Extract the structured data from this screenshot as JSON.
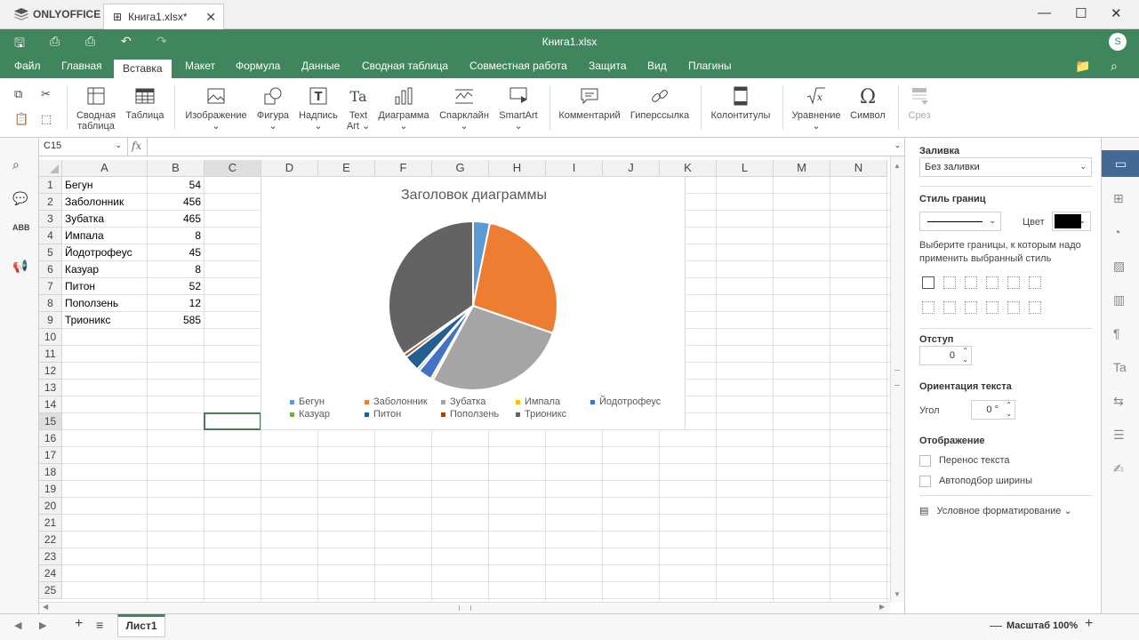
{
  "app": {
    "brand": "ONLYOFFICE",
    "doc_tab": "Книга1.xlsx*",
    "title": "Книга1.xlsx",
    "avatar": "S"
  },
  "menu": [
    "Файл",
    "Главная",
    "Вставка",
    "Макет",
    "Формула",
    "Данные",
    "Сводная таблица",
    "Совместная работа",
    "Защита",
    "Вид",
    "Плагины"
  ],
  "menu_active": "Вставка",
  "toolbar": {
    "pivot": [
      "Сводная",
      "таблица"
    ],
    "table": "Таблица",
    "image": "Изображение",
    "shape": "Фигура",
    "textbox": "Надпись",
    "textart": [
      "Text",
      "Art"
    ],
    "chart": "Диаграмма",
    "sparkline": "Спарклайн",
    "smartart": "SmartArt",
    "comment": "Комментарий",
    "hyperlink": "Гиперссылка",
    "headers": "Колонтитулы",
    "equation": "Уравнение",
    "symbol": "Символ",
    "slicer": "Срез"
  },
  "formula_bar": {
    "cell_ref": "C15",
    "fx": "fx",
    "value": ""
  },
  "columns": [
    "A",
    "B",
    "C",
    "D",
    "E",
    "F",
    "G",
    "H",
    "I",
    "J",
    "K",
    "L",
    "M",
    "N"
  ],
  "selected_col": "C",
  "selected_row": "15",
  "rows": [
    "1",
    "2",
    "3",
    "4",
    "5",
    "6",
    "7",
    "8",
    "9",
    "10",
    "11",
    "12",
    "13",
    "14",
    "15",
    "16",
    "17",
    "18",
    "19",
    "20",
    "21",
    "22",
    "23",
    "24",
    "25"
  ],
  "cells": [
    {
      "name": "Бегун",
      "value": "54"
    },
    {
      "name": "Заболонник",
      "value": "456"
    },
    {
      "name": "Зубатка",
      "value": "465"
    },
    {
      "name": "Импала",
      "value": "8"
    },
    {
      "name": "Йодотрофеус",
      "value": "45"
    },
    {
      "name": "Казуар",
      "value": "8"
    },
    {
      "name": "Питон",
      "value": "52"
    },
    {
      "name": "Поползень",
      "value": "12"
    },
    {
      "name": "Трионикс",
      "value": "585"
    }
  ],
  "chart_data": {
    "type": "pie",
    "title": "Заголовок диаграммы",
    "categories": [
      "Бегун",
      "Заболонник",
      "Зубатка",
      "Импала",
      "Йодотрофеус",
      "Казуар",
      "Питон",
      "Поползень",
      "Трионикс"
    ],
    "values": [
      54,
      456,
      465,
      8,
      45,
      8,
      52,
      12,
      585
    ],
    "colors": [
      "#5b9bd5",
      "#ed7d31",
      "#a5a5a5",
      "#ffc000",
      "#4472c4",
      "#70ad47",
      "#255e91",
      "#9e480e",
      "#636363"
    ],
    "legend": "bottom"
  },
  "right_panel": {
    "fill_label": "Заливка",
    "fill_value": "Без заливки",
    "border_style_label": "Стиль границ",
    "color_label": "Цвет",
    "border_color": "#000000",
    "border_hint": [
      "Выберите границы, к которым надо",
      "применить выбранный стиль"
    ],
    "indent_label": "Отступ",
    "indent_value": "0",
    "orient_label": "Ориентация текста",
    "angle_label": "Угол",
    "angle_value": "0 °",
    "display_label": "Отображение",
    "wrap_label": "Перенос текста",
    "autofit_label": "Автоподбор ширины",
    "cond_format": "Условное форматирование"
  },
  "status": {
    "sheet": "Лист1",
    "zoom": "Масштаб 100%"
  }
}
